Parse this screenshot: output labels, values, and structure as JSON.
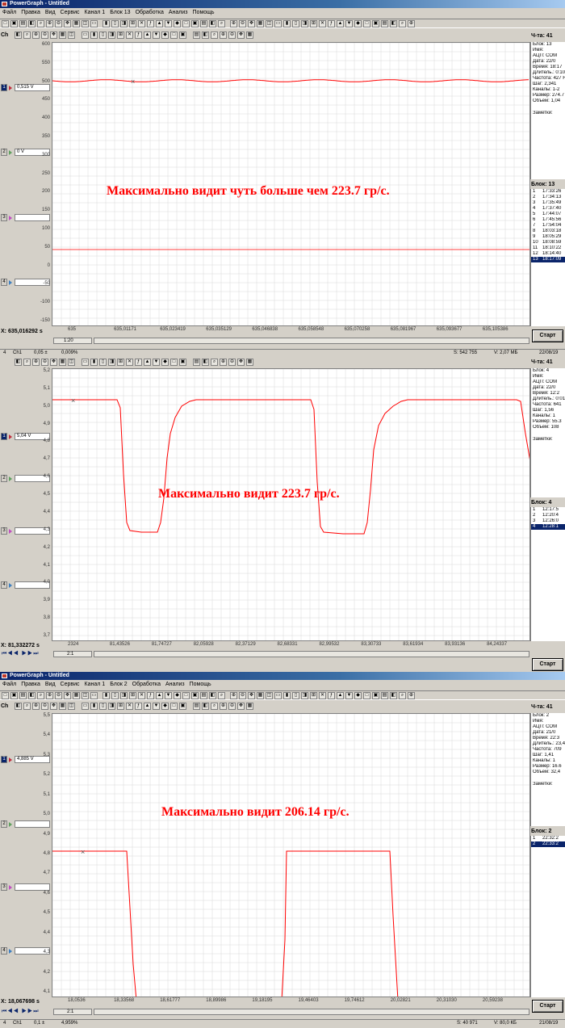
{
  "windows": [
    {
      "title": "PowerGraph - Untitled",
      "menu": [
        "Файл",
        "Правка",
        "Вид",
        "Сервис",
        "Канал 1",
        "Блок 13",
        "Обработка",
        "Анализ",
        "Помощь"
      ],
      "channel_label": "Ch",
      "counter_label": "Ч-та: 41",
      "channels": [
        {
          "num": "1",
          "value": "0,515 V",
          "active": true
        },
        {
          "num": "2",
          "value": "0 V",
          "active": false
        },
        {
          "num": "3",
          "value": "",
          "active": false
        },
        {
          "num": "4",
          "value": "",
          "active": false
        }
      ],
      "y_ticks": [
        "600",
        "550",
        "500",
        "450",
        "400",
        "350",
        "300",
        "250",
        "200",
        "150",
        "100",
        "50",
        "0",
        "-50",
        "-100",
        "-150"
      ],
      "x_ticks": [
        "635",
        "635,01171",
        "635,023419",
        "635,035129",
        "635,046838",
        "635,058548",
        "635,070258",
        "635,081967",
        "635,093677",
        "635,105386"
      ],
      "cursor_readout": "X: 635,016292 s",
      "scroll_label": "1:20",
      "annotation": "Максимально видит чуть больше чем 223.7 гр/с.",
      "info_lines": [
        "Блок: 13",
        "Имя:",
        "АЦП:",
        "Дата:",
        "Время:",
        "Длитель.:",
        "Частота:",
        "Шаг:",
        "Каналы: 1-2",
        "Размер:",
        "Объем:"
      ],
      "info_values": [
        "",
        "",
        "COM",
        "22/0",
        "18:17",
        "0:10:",
        "427 H",
        "2,341",
        "",
        "274.7",
        "1,04"
      ],
      "notes_label": "Заметки:",
      "block_header": "Блок: 13",
      "blocks": [
        {
          "n": "1",
          "t": "17:33:26"
        },
        {
          "n": "2",
          "t": "17:34:13"
        },
        {
          "n": "3",
          "t": "17:35:49"
        },
        {
          "n": "4",
          "t": "17:37:40"
        },
        {
          "n": "5",
          "t": "17:44:07"
        },
        {
          "n": "6",
          "t": "17:45:56"
        },
        {
          "n": "7",
          "t": "17:54:04"
        },
        {
          "n": "8",
          "t": "18:03:18"
        },
        {
          "n": "9",
          "t": "18:05:29"
        },
        {
          "n": "10",
          "t": "18:08:59"
        },
        {
          "n": "11",
          "t": "18:10:22"
        },
        {
          "n": "12",
          "t": "18:14:40"
        },
        {
          "n": "13",
          "t": "18:17:09"
        }
      ],
      "start_label": "Старт",
      "status": {
        "ch_num": "4",
        "ch": "Ch1",
        "scale": "0,05 ±",
        "pct": "0,009%",
        "samples": "S: 542 755",
        "volume": "V: 2,07 МБ",
        "date": "22/08/19"
      }
    },
    {
      "counter_label": "Ч-та: 41",
      "channels": [
        {
          "num": "1",
          "value": "5,04 V",
          "active": true
        },
        {
          "num": "2",
          "value": "",
          "active": false
        },
        {
          "num": "3",
          "value": "",
          "active": false
        },
        {
          "num": "4",
          "value": "",
          "active": false
        }
      ],
      "y_ticks": [
        "5,2",
        "5,1",
        "5,0",
        "4,9",
        "4,8",
        "4,7",
        "4,6",
        "4,5",
        "4,4",
        "4,3",
        "4,2",
        "4,1",
        "4,0",
        "3,9",
        "3,8",
        "3,7"
      ],
      "x_ticks": [
        "2324",
        "81,43526",
        "81,74727",
        "82,05928",
        "82,37129",
        "82,68331",
        "82,99532",
        "83,30733",
        "83,61934",
        "83,93136",
        "84,24337"
      ],
      "cursor_readout": "X: 81,332272 s",
      "scroll_label": "2:1",
      "annotation": "Максимально видит 223.7 гр/с.",
      "info_lines": [
        "Блок: 4",
        "Имя:",
        "АЦП:",
        "Дата:",
        "Время:",
        "Длитель.:",
        "Частота:",
        "Шаг:",
        "Каналы: 1",
        "Размер:",
        "Объем:"
      ],
      "info_values": [
        "",
        "",
        "COM",
        "22/0",
        "12:2",
        "0:01",
        "641",
        "1,56",
        "",
        "55.3",
        "108"
      ],
      "notes_label": "Заметки:",
      "block_header": "Блок: 4",
      "blocks": [
        {
          "n": "1",
          "t": "12:17:5"
        },
        {
          "n": "2",
          "t": "12:20:4"
        },
        {
          "n": "3",
          "t": "12:26:0"
        },
        {
          "n": "4",
          "t": "12:28:1"
        }
      ],
      "start_label": "Старт"
    },
    {
      "title": "PowerGraph - Untitled",
      "menu": [
        "Файл",
        "Правка",
        "Вид",
        "Сервис",
        "Канал 1",
        "Блок 2",
        "Обработка",
        "Анализ",
        "Помощь"
      ],
      "channel_label": "Ch",
      "counter_label": "Ч-та: 41",
      "channels": [
        {
          "num": "1",
          "value": "4,885 V",
          "active": true
        },
        {
          "num": "2",
          "value": "",
          "active": false
        },
        {
          "num": "3",
          "value": "",
          "active": false
        },
        {
          "num": "4",
          "value": "",
          "active": false
        }
      ],
      "y_ticks": [
        "5,5",
        "5,4",
        "5,3",
        "5,2",
        "5,1",
        "5,0",
        "4,9",
        "4,8",
        "4,7",
        "4,6",
        "4,5",
        "4,4",
        "4,3",
        "4,2",
        "4,1"
      ],
      "x_ticks": [
        "18,0536",
        "18,33568",
        "18,61777",
        "18,89986",
        "19,18195",
        "19,46403",
        "19,74612",
        "20,02821",
        "20,31030",
        "20,59238"
      ],
      "cursor_readout": "X: 18,067698 s",
      "scroll_label": "2:1",
      "annotation": "Максимально видит 206.14 гр/с.",
      "info_lines": [
        "Блок: 2",
        "Имя:",
        "АЦП:",
        "Дата:",
        "Время:",
        "Длитель.:",
        "Частота:",
        "Шаг:",
        "Каналы: 1",
        "Размер:",
        "Объем:"
      ],
      "info_values": [
        "",
        "",
        "COM",
        "21/0",
        "22:3",
        "23,4",
        "709",
        "1,41",
        "",
        "16.6",
        "32,4"
      ],
      "notes_label": "Заметки:",
      "block_header": "Блок: 2",
      "blocks": [
        {
          "n": "1",
          "t": "22:32:2"
        },
        {
          "n": "2",
          "t": "22:33:2"
        }
      ],
      "start_label": "Старт",
      "status": {
        "ch_num": "4",
        "ch": "Ch1",
        "scale": "0,1 ±",
        "pct": "4,959%",
        "samples": "S: 40 971",
        "volume": "V: 80,0 КБ",
        "date": "21/08/19"
      }
    }
  ],
  "colors": {
    "trace": "#ff0000",
    "annotation": "#ff0000",
    "title": "#0a246a",
    "grid": "#d8d8d8"
  }
}
